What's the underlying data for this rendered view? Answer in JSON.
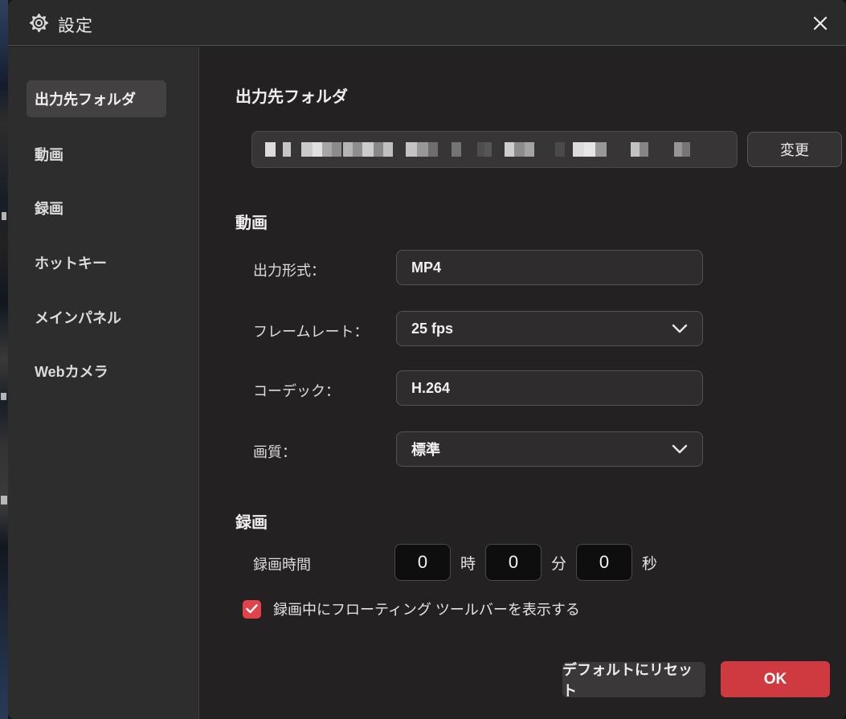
{
  "window": {
    "title": "設定"
  },
  "sidebar": {
    "items": [
      {
        "label": "出力先フォルダ",
        "selected": true
      },
      {
        "label": "動画",
        "selected": false
      },
      {
        "label": "録画",
        "selected": false
      },
      {
        "label": "ホットキー",
        "selected": false
      },
      {
        "label": "メインパネル",
        "selected": false
      },
      {
        "label": "Webカメラ",
        "selected": false
      }
    ]
  },
  "output_folder": {
    "heading": "出力先フォルダ",
    "path_redacted": true,
    "redacted_blocks": [
      [
        13,
        9,
        "#dcdcdc"
      ],
      [
        10,
        13,
        "#c6c6c6"
      ],
      [
        14,
        0,
        "#cacaca"
      ],
      [
        12,
        0,
        "#e0e0e0"
      ],
      [
        12,
        0,
        "#a6a6a6"
      ],
      [
        12,
        2,
        "#8c8c8c"
      ],
      [
        12,
        0,
        "#b4b4b4"
      ],
      [
        12,
        0,
        "#8e8e8e"
      ],
      [
        14,
        0,
        "#cccccc"
      ],
      [
        12,
        0,
        "#888888"
      ],
      [
        12,
        16,
        "#c0c0c0"
      ],
      [
        14,
        0,
        "#c4c4c4"
      ],
      [
        14,
        0,
        "#989898"
      ],
      [
        12,
        17,
        "#6e6e6e"
      ],
      [
        12,
        20,
        "#747474"
      ],
      [
        9,
        0,
        "#4e4e4e"
      ],
      [
        9,
        16,
        "#565656"
      ],
      [
        12,
        0,
        "#cecece"
      ],
      [
        13,
        0,
        "#8c8c8c"
      ],
      [
        12,
        26,
        "#a4a4a4"
      ],
      [
        12,
        10,
        "#4a4a4a"
      ],
      [
        14,
        0,
        "#dcdcdc"
      ],
      [
        14,
        0,
        "#e6e6e6"
      ],
      [
        14,
        30,
        "#989898"
      ],
      [
        11,
        0,
        "#c2c2c2"
      ],
      [
        11,
        32,
        "#868686"
      ],
      [
        10,
        0,
        "#969696"
      ],
      [
        10,
        0,
        "#767676"
      ]
    ],
    "change_button": "変更"
  },
  "video": {
    "heading": "動画",
    "fields": [
      {
        "label": "出力形式：",
        "value": "MP4",
        "type": "text"
      },
      {
        "label": "フレームレート：",
        "value": "25 fps",
        "type": "dropdown"
      },
      {
        "label": "コーデック：",
        "value": "H.264",
        "type": "text"
      },
      {
        "label": "画質：",
        "value": "標準",
        "type": "dropdown"
      }
    ]
  },
  "recording": {
    "heading": "録画",
    "duration_label": "録画時間",
    "time_fields": [
      {
        "value": "0",
        "unit": "時"
      },
      {
        "value": "0",
        "unit": "分"
      },
      {
        "value": "0",
        "unit": "秒"
      }
    ],
    "checkbox": {
      "checked": true,
      "label": "録画中にフローティング ツールバーを表示する"
    }
  },
  "footer": {
    "reset_button": "デフォルトにリセット",
    "ok_button": "OK"
  },
  "colors": {
    "accent_red": "#cf3a40",
    "checkbox_red": "#e2434b",
    "dialog_bg": "#232121",
    "sidebar_bg": "#2e2d2d"
  }
}
